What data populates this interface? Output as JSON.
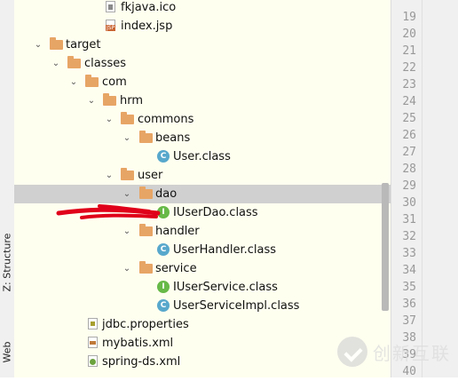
{
  "side_tabs": {
    "structure": "Z: Structure",
    "web": "Web"
  },
  "tree": {
    "rows": [
      {
        "label": "fkjava.ico"
      },
      {
        "label": "index.jsp"
      },
      {
        "label": "target"
      },
      {
        "label": "classes"
      },
      {
        "label": "com"
      },
      {
        "label": "hrm"
      },
      {
        "label": "commons"
      },
      {
        "label": "beans"
      },
      {
        "label": "User.class",
        "icon_text": "C"
      },
      {
        "label": "user"
      },
      {
        "label": "dao",
        "selected": true
      },
      {
        "label": "IUserDao.class",
        "icon_text": "I"
      },
      {
        "label": "handler"
      },
      {
        "label": "UserHandler.class",
        "icon_text": "C"
      },
      {
        "label": "service"
      },
      {
        "label": "IUserService.class",
        "icon_text": "I"
      },
      {
        "label": "UserServiceImpl.class",
        "icon_text": "C"
      },
      {
        "label": "jdbc.properties"
      },
      {
        "label": "mybatis.xml"
      },
      {
        "label": "spring-ds.xml"
      }
    ]
  },
  "gutter": {
    "line_numbers": [
      "19",
      "20",
      "21",
      "22",
      "23",
      "24",
      "25",
      "26",
      "27",
      "28",
      "29",
      "30",
      "31",
      "32",
      "33",
      "34",
      "35",
      "36",
      "37",
      "38",
      "39",
      "40",
      "41"
    ]
  },
  "watermark": {
    "text": "创新互联"
  },
  "colors": {
    "tree_bg": "#fffff0",
    "selection": "#d0d0d0",
    "folder": "#e7a565",
    "class_icon": "#58a8cc",
    "interface_icon": "#67b948",
    "annotation": "#e0001a"
  }
}
